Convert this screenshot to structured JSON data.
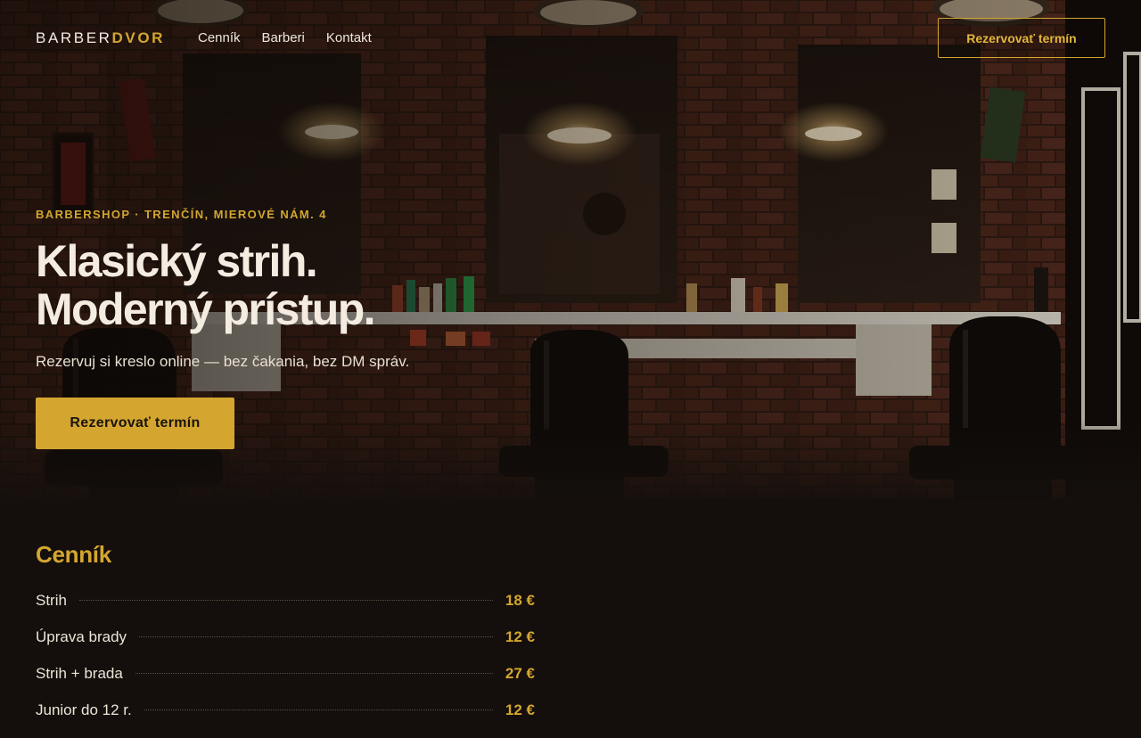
{
  "nav": {
    "logo_main": "BARBER",
    "logo_accent": "DVOR",
    "links": [
      "Cenník",
      "Barberi",
      "Kontakt"
    ],
    "cta_label": "Rezervovať termín"
  },
  "hero": {
    "eyebrow": "BARBERSHOP · TRENČÍN, MIEROVÉ NÁM. 4",
    "headline_line1": "Klasický strih.",
    "headline_line2": "Moderný prístup.",
    "subline": "Rezervuj si kreslo online — bez čakania, bez DM správ.",
    "cta_label": "Rezervovať termín"
  },
  "pricing": {
    "title": "Cenník",
    "items": [
      {
        "name": "Strih",
        "price": "18 €"
      },
      {
        "name": "Úprava brady",
        "price": "12 €"
      },
      {
        "name": "Strih + brada",
        "price": "27 €"
      },
      {
        "name": "Junior do 12 r.",
        "price": "12 €"
      }
    ]
  },
  "colors": {
    "accent": "#d4a630",
    "background": "#140f0c",
    "text": "#ede4d6"
  }
}
